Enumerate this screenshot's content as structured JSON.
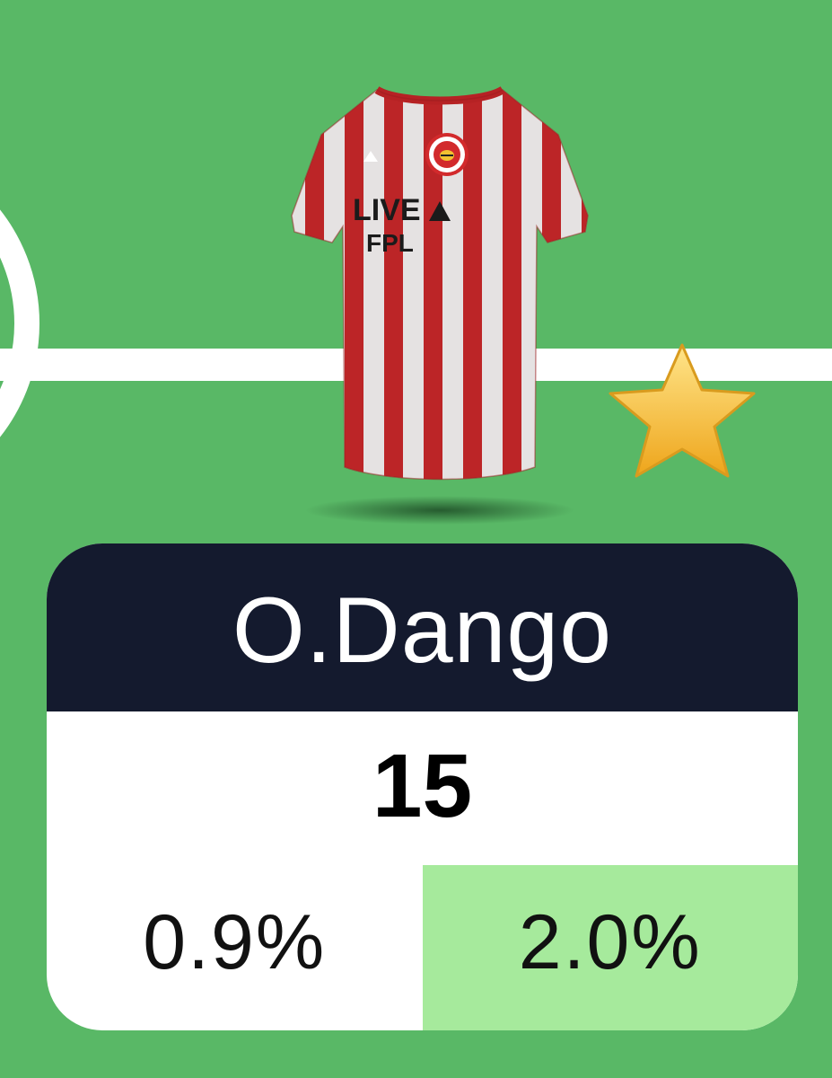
{
  "colors": {
    "pitch": "#59b866",
    "pitch_lines": "#ffffff",
    "name_bar": "#141a2e",
    "highlight_stat_bg": "#a6ea9c",
    "shirt_red": "#c8282a",
    "shirt_white": "#f4f1f1",
    "star": "#f3c02e"
  },
  "shirt": {
    "icon": "striped-red-white-shirt-icon",
    "sponsor_line1": "LIVE",
    "sponsor_line2": "FPL"
  },
  "badge": {
    "icon": "star-icon"
  },
  "player": {
    "name": "O.Dango",
    "points": "15",
    "stat_left": "0.9%",
    "stat_right": "2.0%"
  }
}
